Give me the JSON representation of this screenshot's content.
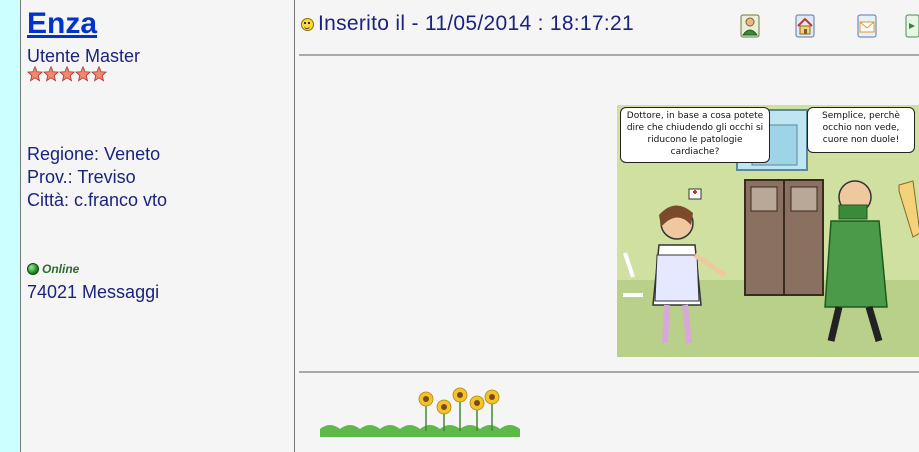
{
  "author": {
    "name": "Enza",
    "rank": "Utente Master",
    "stars": 5,
    "region": "Regione: Veneto",
    "province": "Prov.: Treviso",
    "city": "Città: c.franco vto",
    "status": "Online",
    "messages": "74021 Messaggi"
  },
  "post": {
    "header": "Inserito il  -  11/05/2014 : 18:17:21",
    "comic": {
      "bubble_left": "Dottore, in base a cosa potete dire che chiudendo gli occhi si riducono le patologie cardiache?",
      "bubble_right": "Semplice, perchè occhio non vede, cuore non duole!"
    }
  },
  "tools": [
    {
      "icon": "profile-icon"
    },
    {
      "icon": "homepage-icon"
    },
    {
      "icon": "email-icon"
    },
    {
      "icon": "reply-quote-icon"
    }
  ],
  "colors": {
    "page_bg": "#ccffff",
    "panel_bg": "#f5f5f5",
    "username": "#0033cc",
    "text": "#1a237e",
    "online": "#2e6b2e"
  }
}
